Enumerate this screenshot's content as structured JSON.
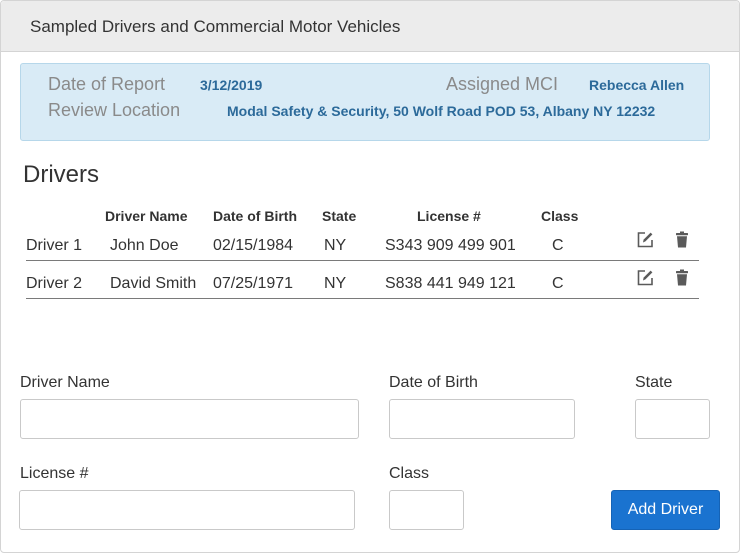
{
  "panel": {
    "title": "Sampled Drivers and Commercial Motor Vehicles"
  },
  "report": {
    "date_label": "Date of Report",
    "date_value": "3/12/2019",
    "mci_label": "Assigned MCI",
    "mci_value": "Rebecca Allen",
    "location_label": "Review Location",
    "location_value": "Modal Safety & Security, 50 Wolf Road POD 53, Albany NY 12232"
  },
  "drivers": {
    "title": "Drivers",
    "columns": {
      "name": "Driver Name",
      "dob": "Date of Birth",
      "state": "State",
      "license": "License #",
      "class": "Class"
    },
    "rows": [
      {
        "label": "Driver 1",
        "name": "John Doe",
        "dob": "02/15/1984",
        "state": "NY",
        "license": "S343 909 499 901",
        "class": "C"
      },
      {
        "label": "Driver 2",
        "name": "David Smith",
        "dob": "07/25/1971",
        "state": "NY",
        "license": "S838 441 949 121",
        "class": "C"
      }
    ]
  },
  "form": {
    "name_label": "Driver Name",
    "dob_label": "Date of Birth",
    "state_label": "State",
    "license_label": "License #",
    "class_label": "Class",
    "submit_label": "Add Driver"
  },
  "icons": {
    "edit": "edit-icon",
    "delete": "trash-icon"
  },
  "colors": {
    "accent": "#1a73d0",
    "info_bg": "#d9ebf6",
    "info_value": "#2c6a9a"
  }
}
